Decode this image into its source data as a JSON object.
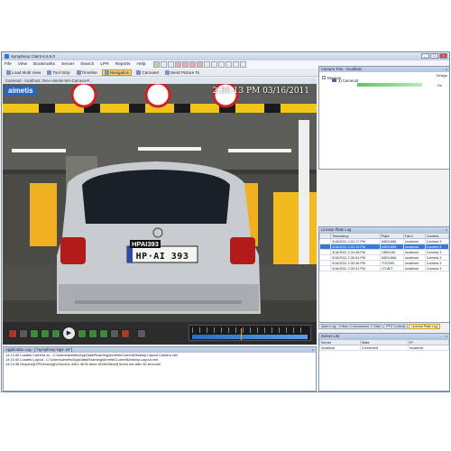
{
  "window": {
    "title": "Symphony Client 6.6.0.0"
  },
  "menu": [
    "File",
    "View",
    "Bookmarks",
    "Server",
    "Search",
    "LPR",
    "Reports",
    "Help"
  ],
  "toolbar": [
    {
      "label": "Load Multi View",
      "active": false
    },
    {
      "label": "Tool Strip",
      "active": false
    },
    {
      "label": "Timeline",
      "active": false
    },
    {
      "label": "Navigation",
      "active": true
    },
    {
      "label": "Carousel",
      "active": false
    },
    {
      "label": "Send Picture To",
      "active": false
    }
  ],
  "video": {
    "header": "Camera3 - localhost: Dev-Aimetis-WA-Camera-P...",
    "logo": "aimetis",
    "timestamp": "2:31:13 PM 03/16/2011",
    "plate_overlay": "HPAI393",
    "plate_text": "HP·AI 393"
  },
  "timeline": {
    "marker_fraction": 0.42
  },
  "app_log": {
    "title": "Application Log - [\"\\symphony-logs-.txt\"]",
    "lines": [
      "14:13:40 Loaded Camera xx - C:\\Users\\aimetis\\AppData\\Roaming\\Aimetis\\CurrentDesktop.Layout.Camera.xml",
      "14:13:40 Loaded Layout - C:\\Users\\aimetis\\AppData\\Roaming\\Aimetis\\CurrentDesktop.Layout.xml",
      "14:14:38 Request[LPRVersion][b244c404-4061-4b78-bbee-bf19e08ecef] timed out after 30 seconds"
    ]
  },
  "camera_tree": {
    "title": "Camera Tree - localhost",
    "design": "Design",
    "root": "Devices",
    "child": "3) Camera3",
    "status": "On"
  },
  "lpr_log": {
    "title": "License Plate Log",
    "columns": [
      "Timestamp",
      "Plate",
      "Farm",
      "Camera"
    ],
    "rows": [
      [
        "3/16/2011 2:31:17 PM",
        "ABGL856",
        "localhost",
        "Camera 3"
      ],
      [
        "3/16/2011 2:31:13 PM",
        "ABGL856",
        "localhost",
        "Camera 3"
      ],
      [
        "3/16/2011 2:31:08 PM",
        "19BXXM",
        "localhost",
        "Camera 3"
      ],
      [
        "3/16/2011 2:30:54 PM",
        "ABGL856",
        "localhost",
        "Camera 3"
      ],
      [
        "3/16/2011 2:30:46 PM",
        "TOV399",
        "localhost",
        "Camera 3"
      ],
      [
        "3/16/2011 2:30:31 PM",
        "LTL807",
        "localhost",
        "Camera 3"
      ]
    ],
    "selected_row": 1
  },
  "bottom_tabs": [
    "Alarm Log - 0 New, 0 Unresolved, 1 Total",
    "PTZ Controls",
    "License Plate Log"
  ],
  "server_list": {
    "title": "Server List",
    "columns": [
      "Server",
      "State",
      "IP"
    ],
    "rows": [
      [
        "localhost",
        "Connected",
        "localhost"
      ]
    ]
  }
}
